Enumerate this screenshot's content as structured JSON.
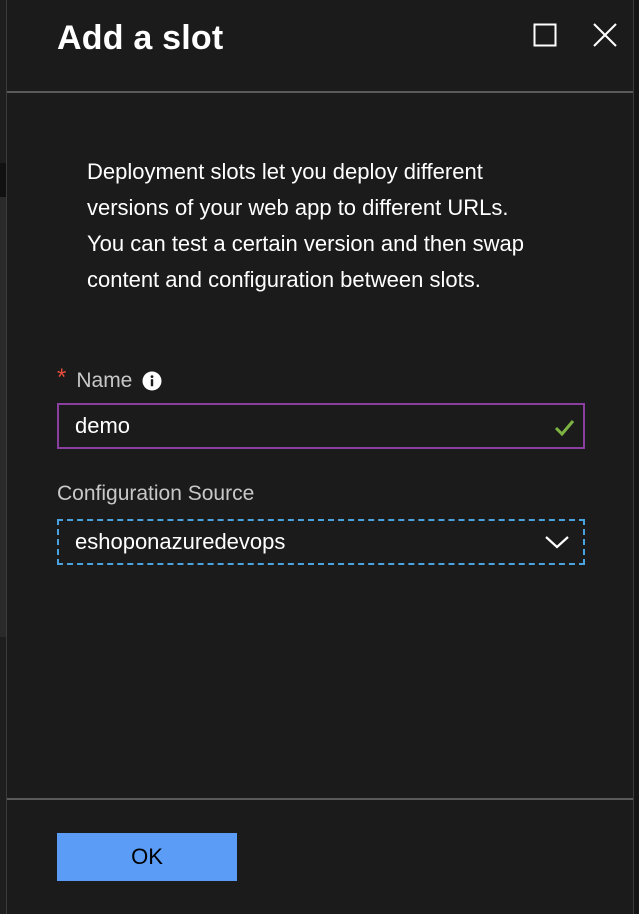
{
  "dialog": {
    "title": "Add a slot",
    "description": "Deployment slots let you deploy different versions of your web app to different URLs. You can test a certain version and then swap content and configuration between slots."
  },
  "header_buttons": {
    "maximize_icon": "square-icon",
    "close_icon": "x-icon"
  },
  "name_field": {
    "required_marker": "*",
    "label": "Name",
    "info_icon": "info-icon",
    "value": "demo",
    "validation_icon": "checkmark-icon"
  },
  "config_source": {
    "label": "Configuration Source",
    "selected": "eshoponazuredevops",
    "dropdown_icon": "chevron-down-icon"
  },
  "footer": {
    "ok_label": "OK"
  },
  "colors": {
    "background": "#1b1b1b",
    "input_focus_border": "#8a3fa0",
    "select_focus_border": "#4aa3df",
    "primary_button": "#5b9cf6",
    "valid_check": "#7cb342",
    "required_star": "#e74c3c"
  }
}
